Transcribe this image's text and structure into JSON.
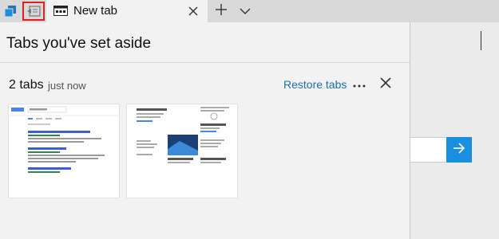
{
  "colors": {
    "accent": "#1a8fe0",
    "link": "#1f6ea8",
    "highlight": "#e02020"
  },
  "tabbar": {
    "tab": {
      "title": "New tab"
    }
  },
  "panel": {
    "title": "Tabs you've set aside",
    "group": {
      "count_label": "2 tabs",
      "time_label": "just now",
      "restore_label": "Restore tabs",
      "more_label": "···"
    },
    "thumbnails": [
      {
        "name": "search-results-thumbnail"
      },
      {
        "name": "article-thumbnail"
      }
    ]
  },
  "icons": [
    "tabs-icon",
    "set-aside-icon",
    "page-favicon-icon",
    "close-icon",
    "plus-icon",
    "chevron-down-icon",
    "more-icon",
    "close-icon",
    "arrow-right-icon"
  ]
}
